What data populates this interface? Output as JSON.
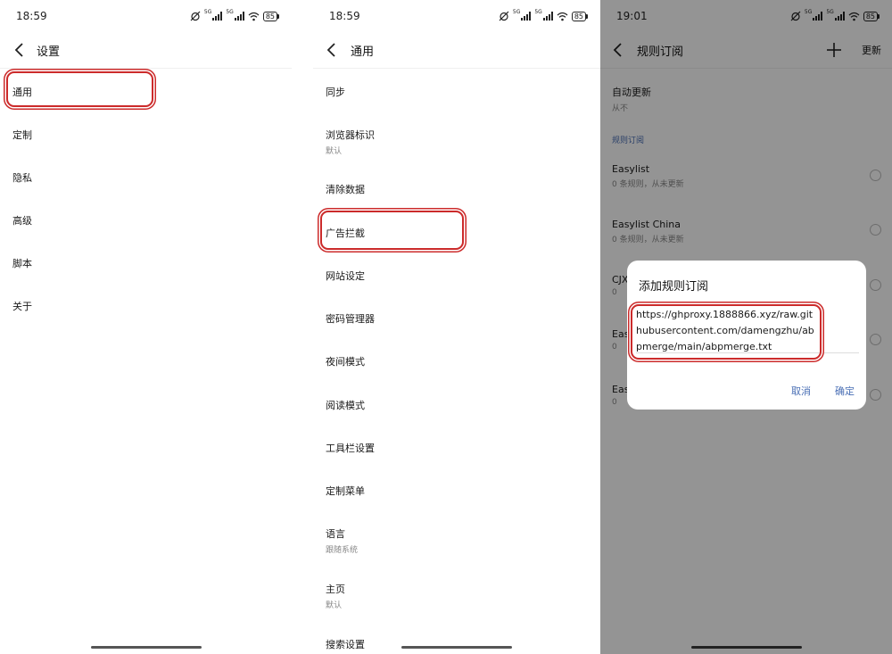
{
  "colors": {
    "highlight": "#cc2b2b",
    "accent": "#4a6fb5",
    "overlay": "rgba(0,0,0,0.42)"
  },
  "panel1": {
    "status": {
      "time": "18:59",
      "battery": "85"
    },
    "title": "设置",
    "items": [
      "通用",
      "定制",
      "隐私",
      "高级",
      "脚本",
      "关于"
    ]
  },
  "panel2": {
    "status": {
      "time": "18:59",
      "battery": "85"
    },
    "title": "通用",
    "items": [
      {
        "label": "同步",
        "sub": ""
      },
      {
        "label": "浏览器标识",
        "sub": "默认"
      },
      {
        "label": "清除数据",
        "sub": ""
      },
      {
        "label": "广告拦截",
        "sub": ""
      },
      {
        "label": "网站设定",
        "sub": ""
      },
      {
        "label": "密码管理器",
        "sub": ""
      },
      {
        "label": "夜间模式",
        "sub": ""
      },
      {
        "label": "阅读模式",
        "sub": ""
      },
      {
        "label": "工具栏设置",
        "sub": ""
      },
      {
        "label": "定制菜单",
        "sub": ""
      },
      {
        "label": "语言",
        "sub": "跟随系统"
      },
      {
        "label": "主页",
        "sub": "默认"
      },
      {
        "label": "搜索设置",
        "sub": ""
      }
    ]
  },
  "panel3": {
    "status": {
      "time": "19:01",
      "battery": "85"
    },
    "title": "规则订阅",
    "update_label": "更新",
    "auto_update": {
      "label": "自动更新",
      "value": "从不"
    },
    "section": "规则订阅",
    "subscriptions": [
      {
        "name": "Easylist",
        "status": "0 条规则，从未更新"
      },
      {
        "name": "Easylist China",
        "status": "0 条规则，从未更新"
      },
      {
        "name": "CJX",
        "status": "0"
      },
      {
        "name": "Eas",
        "status": "0"
      },
      {
        "name": "Eas",
        "status": "0"
      }
    ],
    "dialog": {
      "title": "添加规则订阅",
      "url": "https://ghproxy.1888866.xyz/raw.githubusercontent.com/damengzhu/abpmerge/main/abpmerge.txt",
      "cancel": "取消",
      "confirm": "确定"
    }
  }
}
